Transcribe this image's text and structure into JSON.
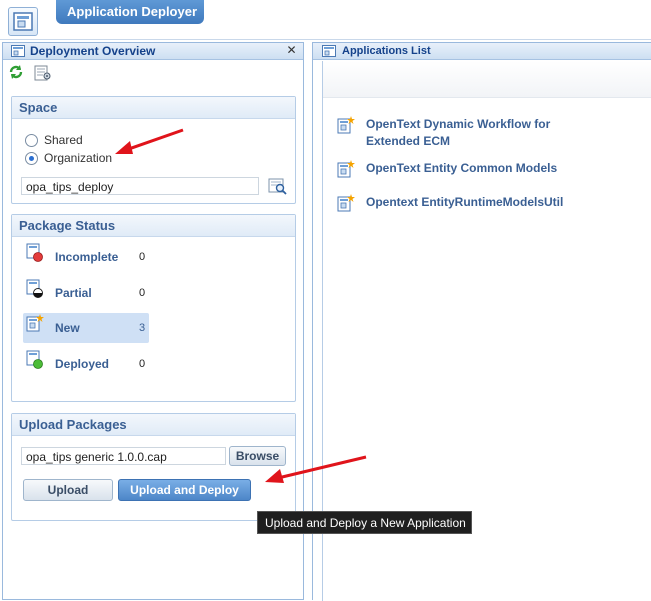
{
  "app": {
    "title": "Application Deployer"
  },
  "left_panel": {
    "title": "Deployment Overview",
    "close_icon": "close-icon",
    "toolbar": {
      "refresh_icon": "refresh-icon",
      "settings_icon": "edit-settings-icon"
    }
  },
  "space": {
    "title": "Space",
    "options": [
      {
        "label": "Shared",
        "checked": false
      },
      {
        "label": "Organization",
        "checked": true
      }
    ],
    "value": "opa_tips_deploy"
  },
  "package_status": {
    "title": "Package Status",
    "items": [
      {
        "label": "Incomplete",
        "count": "0",
        "selected": false,
        "icon": "incomplete-package-icon"
      },
      {
        "label": "Partial",
        "count": "0",
        "selected": false,
        "icon": "partial-package-icon"
      },
      {
        "label": "New",
        "count": "3",
        "selected": true,
        "icon": "new-package-icon"
      },
      {
        "label": "Deployed",
        "count": "0",
        "selected": false,
        "icon": "deployed-package-icon"
      }
    ]
  },
  "upload": {
    "title": "Upload Packages",
    "file_value": "opa_tips generic 1.0.0.cap",
    "browse_label": "Browse",
    "upload_label": "Upload",
    "upload_deploy_label": "Upload and Deploy"
  },
  "right_panel": {
    "title": "Applications List",
    "items": [
      {
        "label_line1": "OpenText Dynamic Workflow for",
        "label_line2": "Extended ECM"
      },
      {
        "label_line1": "OpenText Entity Common Models"
      },
      {
        "label_line1": "Opentext EntityRuntimeModelsUtil"
      }
    ]
  },
  "tooltip": {
    "text": "Upload and Deploy a New Application"
  },
  "colors": {
    "accent": "#3f79bd",
    "header_text": "#15428b",
    "link_text": "#3a5f93",
    "annotation_arrow": "#e0141b"
  }
}
